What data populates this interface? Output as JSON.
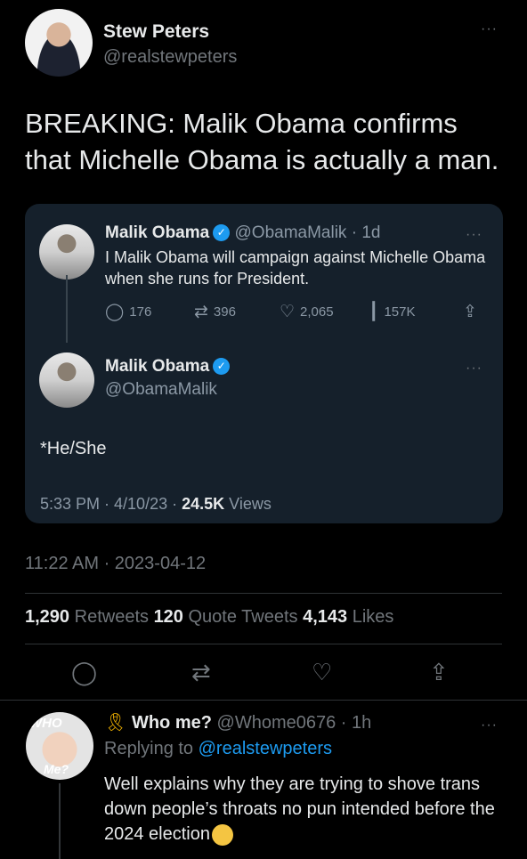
{
  "main_tweet": {
    "author_name": "Stew Peters",
    "author_handle": "@realstewpeters",
    "more_label": "···",
    "text": "BREAKING: Malik Obama confirms that Michelle Obama is actually a man.",
    "timestamp": "11:22 AM · 2023-04-12",
    "stats": {
      "retweets_count": "1,290",
      "retweets_label": "Retweets",
      "quote_count": "120",
      "quote_label": "Quote Tweets",
      "likes_count": "4,143",
      "likes_label": "Likes"
    },
    "actions": [
      "reply-icon",
      "retweet-icon",
      "like-icon",
      "share-icon"
    ]
  },
  "quoted": {
    "parent": {
      "author_name": "Malik Obama",
      "author_handle": "@ObamaMalik",
      "time": "· 1d",
      "more_label": "···",
      "text": "I Malik Obama will campaign against Michelle Obama when she runs for President.",
      "reply_count": "176",
      "retweet_count": "396",
      "like_count": "2,065",
      "views_count": "157K"
    },
    "child": {
      "author_name": "Malik Obama",
      "author_handle": "@ObamaMalik",
      "more_label": "···",
      "text": "*He/She",
      "timestamp": "5:33 PM · 4/10/23 · ",
      "views_count": "24.5K",
      "views_label": "Views"
    }
  },
  "reply": {
    "avatar_text_top": "WHO",
    "avatar_text_bottom": "Me?",
    "author_name": "Who me?",
    "author_handle": "@Whome0676",
    "time": "· 1h",
    "more_label": "···",
    "replying_to_label": "Replying to",
    "replying_to_handle": "@realstewpeters",
    "text": "Well explains why they are trying to shove trans down people’s throats no pun intended before the 2024 election"
  },
  "colors": {
    "background": "#000000",
    "card": "#15202b",
    "accent": "#1d9bf0",
    "muted": "#71767b"
  }
}
